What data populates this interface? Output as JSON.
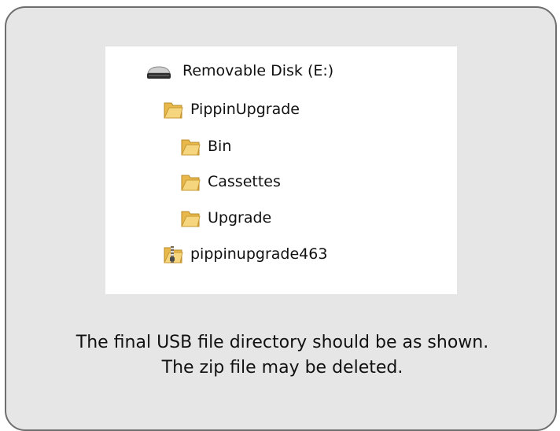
{
  "tree": {
    "drive": {
      "label": "Removable Disk (E:)",
      "icon": "drive-icon"
    },
    "items": [
      {
        "label": "PippinUpgrade",
        "icon": "folder-icon"
      },
      {
        "label": "Bin",
        "icon": "folder-icon"
      },
      {
        "label": "Cassettes",
        "icon": "folder-icon"
      },
      {
        "label": "Upgrade",
        "icon": "folder-icon"
      },
      {
        "label": "pippinupgrade463",
        "icon": "zip-folder-icon"
      }
    ]
  },
  "caption": {
    "line1": "The final USB file directory should be as shown.",
    "line2": "The zip file may be deleted."
  },
  "colors": {
    "card_bg": "#e6e6e6",
    "card_border": "#6e6e6e",
    "folder": "#e8b84a"
  }
}
